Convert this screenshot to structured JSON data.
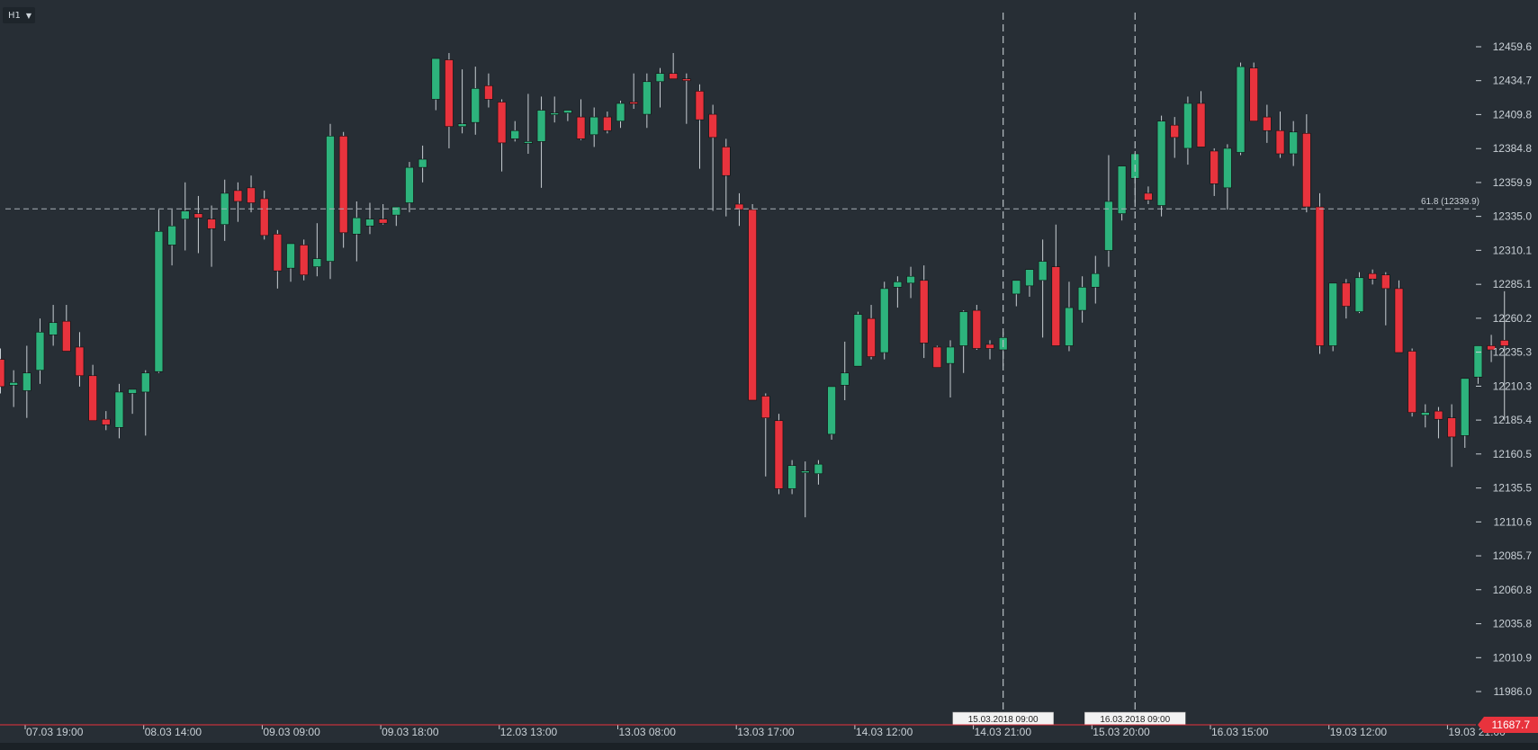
{
  "toolbar": {
    "timeframe": "H1"
  },
  "chart_data": {
    "type": "candlestick",
    "y_ticks": [
      "12459.6",
      "12434.7",
      "12409.8",
      "12384.8",
      "12359.9",
      "12335.0",
      "12310.1",
      "12285.1",
      "12260.2",
      "12235.3",
      "12210.3",
      "12185.4",
      "12160.5",
      "12135.5",
      "12110.6",
      "12085.7",
      "12060.8",
      "12035.8",
      "12010.9",
      "11986.0"
    ],
    "ylim": [
      11980,
      12470
    ],
    "x_ticks": [
      "07.03 19:00",
      "08.03 14:00",
      "09.03 09:00",
      "09.03 18:00",
      "12.03 13:00",
      "13.03 08:00",
      "13.03 17:00",
      "14.03 12:00",
      "14.03 21:00",
      "15.03 20:00",
      "16.03 15:00",
      "19.03 12:00",
      "19.03 21:00"
    ],
    "current_price": {
      "label": "11687.7",
      "color": "#e8333d"
    },
    "fib_level": {
      "label": "61.8 (12339.9)",
      "price": 12339.9
    },
    "vertical_markers": [
      {
        "label": "15.03.2018 09:00",
        "candle_index": 76
      },
      {
        "label": "16.03.2018 09:00",
        "candle_index": 86
      }
    ],
    "colors": {
      "up": "#2db37c",
      "down": "#e8333d",
      "wick": "#c8ced3",
      "grid_text": "#c9d0d6"
    },
    "candles": [
      [
        12230,
        12238,
        12205,
        12210
      ],
      [
        12211,
        12222,
        12195,
        12213
      ],
      [
        12207,
        12240,
        12187,
        12220
      ],
      [
        12222,
        12260,
        12212,
        12250
      ],
      [
        12248,
        12270,
        12240,
        12257
      ],
      [
        12258,
        12270,
        12240,
        12236
      ],
      [
        12239,
        12250,
        12210,
        12218
      ],
      [
        12218,
        12226,
        12185,
        12185
      ],
      [
        12186,
        12192,
        12178,
        12182
      ],
      [
        12180,
        12212,
        12172,
        12206
      ],
      [
        12205,
        12208,
        12190,
        12208
      ],
      [
        12206,
        12222,
        12174,
        12220
      ],
      [
        12221,
        12340,
        12220,
        12324
      ],
      [
        12314,
        12340,
        12299,
        12328
      ],
      [
        12333,
        12360,
        12310,
        12339
      ],
      [
        12337,
        12350,
        12308,
        12334
      ],
      [
        12333,
        12343,
        12298,
        12326
      ],
      [
        12329,
        12362,
        12317,
        12352
      ],
      [
        12354,
        12360,
        12331,
        12346
      ],
      [
        12356,
        12365,
        12338,
        12345
      ],
      [
        12348,
        12354,
        12318,
        12321
      ],
      [
        12322,
        12325,
        12282,
        12295
      ],
      [
        12297,
        12315,
        12287,
        12315
      ],
      [
        12314,
        12318,
        12288,
        12292
      ],
      [
        12298,
        12330,
        12291,
        12304
      ],
      [
        12302,
        12403,
        12289,
        12394
      ],
      [
        12394,
        12397,
        12312,
        12323
      ],
      [
        12322,
        12346,
        12302,
        12334
      ],
      [
        12328,
        12345,
        12322,
        12333
      ],
      [
        12333,
        12344,
        12329,
        12330
      ],
      [
        12336,
        12342,
        12328,
        12342
      ],
      [
        12345,
        12375,
        12338,
        12371
      ],
      [
        12371,
        12387,
        12360,
        12377
      ],
      [
        12421,
        12443,
        12413,
        12451
      ],
      [
        12450,
        12455,
        12385,
        12401
      ],
      [
        12401,
        12443,
        12396,
        12403
      ],
      [
        12404,
        12445,
        12395,
        12429
      ],
      [
        12431,
        12440,
        12415,
        12421
      ],
      [
        12419,
        12421,
        12368,
        12389
      ],
      [
        12392,
        12405,
        12390,
        12398
      ],
      [
        12389,
        12425,
        12381,
        12390
      ],
      [
        12390,
        12423,
        12356,
        12413
      ],
      [
        12410,
        12423,
        12404,
        12411
      ],
      [
        12411,
        12413,
        12405,
        12413
      ],
      [
        12408,
        12421,
        12391,
        12392
      ],
      [
        12395,
        12415,
        12386,
        12408
      ],
      [
        12408,
        12412,
        12396,
        12398
      ],
      [
        12405,
        12420,
        12400,
        12418
      ],
      [
        12419,
        12440,
        12414,
        12418
      ],
      [
        12410,
        12440,
        12400,
        12434
      ],
      [
        12434,
        12444,
        12415,
        12440
      ],
      [
        12440,
        12455,
        12437,
        12436
      ],
      [
        12436,
        12440,
        12403,
        12435
      ],
      [
        12427,
        12432,
        12370,
        12406
      ],
      [
        12410,
        12417,
        12339,
        12393
      ],
      [
        12386,
        12392,
        12335,
        12365
      ],
      [
        12344,
        12352,
        12328,
        12340
      ],
      [
        12340,
        12344,
        12200,
        12200
      ],
      [
        12203,
        12205,
        12144,
        12187
      ],
      [
        12185,
        12190,
        12131,
        12135
      ],
      [
        12135,
        12156,
        12131,
        12152
      ],
      [
        12148,
        12155,
        12114,
        12148
      ],
      [
        12146,
        12156,
        12138,
        12153
      ],
      [
        12175,
        12208,
        12171,
        12210
      ],
      [
        12211,
        12243,
        12200,
        12220
      ],
      [
        12225,
        12265,
        12225,
        12263
      ],
      [
        12260,
        12270,
        12230,
        12232
      ],
      [
        12235,
        12287,
        12230,
        12282
      ],
      [
        12283,
        12291,
        12268,
        12287
      ],
      [
        12286,
        12298,
        12275,
        12291
      ],
      [
        12288,
        12299,
        12231,
        12242
      ],
      [
        12239,
        12240,
        12225,
        12224
      ],
      [
        12227,
        12244,
        12202,
        12239
      ],
      [
        12240,
        12266,
        12220,
        12265
      ],
      [
        12266,
        12270,
        12237,
        12238
      ],
      [
        12241,
        12244,
        12230,
        12238
      ],
      [
        12237,
        12250,
        12225,
        12246
      ],
      [
        12278,
        12286,
        12269,
        12288
      ],
      [
        12284,
        12296,
        12276,
        12296
      ],
      [
        12288,
        12318,
        12246,
        12302
      ],
      [
        12298,
        12329,
        12240,
        12240
      ],
      [
        12240,
        12287,
        12236,
        12268
      ],
      [
        12266,
        12291,
        12257,
        12283
      ],
      [
        12283,
        12306,
        12271,
        12293
      ],
      [
        12310,
        12380,
        12298,
        12346
      ],
      [
        12337,
        12367,
        12332,
        12372
      ],
      [
        12363,
        12383,
        12345,
        12381
      ],
      [
        12352,
        12357,
        12344,
        12347
      ],
      [
        12343,
        12409,
        12335,
        12405
      ],
      [
        12402,
        12408,
        12378,
        12393
      ],
      [
        12385,
        12423,
        12373,
        12418
      ],
      [
        12418,
        12427,
        12386,
        12386
      ],
      [
        12383,
        12385,
        12350,
        12359
      ],
      [
        12356,
        12388,
        12340,
        12385
      ],
      [
        12382,
        12448,
        12380,
        12445
      ],
      [
        12444,
        12448,
        12405,
        12405
      ],
      [
        12408,
        12417,
        12389,
        12398
      ],
      [
        12398,
        12412,
        12378,
        12381
      ],
      [
        12381,
        12405,
        12372,
        12397
      ],
      [
        12396,
        12410,
        12338,
        12342
      ],
      [
        12342,
        12352,
        12234,
        12240
      ],
      [
        12240,
        12285,
        12236,
        12286
      ],
      [
        12286,
        12289,
        12260,
        12269
      ],
      [
        12265,
        12294,
        12264,
        12290
      ],
      [
        12293,
        12296,
        12285,
        12289
      ],
      [
        12292,
        12294,
        12255,
        12282
      ],
      [
        12282,
        12288,
        12235,
        12235
      ],
      [
        12236,
        12238,
        12188,
        12191
      ],
      [
        12189,
        12197,
        12180,
        12191
      ],
      [
        12192,
        12195,
        12172,
        12186
      ],
      [
        12187,
        12197,
        12151,
        12173
      ],
      [
        12174,
        12215,
        12165,
        12216
      ],
      [
        12217,
        12240,
        12212,
        12240
      ],
      [
        12240,
        12248,
        12228,
        12237
      ],
      [
        12244,
        12280,
        12185,
        12240
      ]
    ]
  }
}
